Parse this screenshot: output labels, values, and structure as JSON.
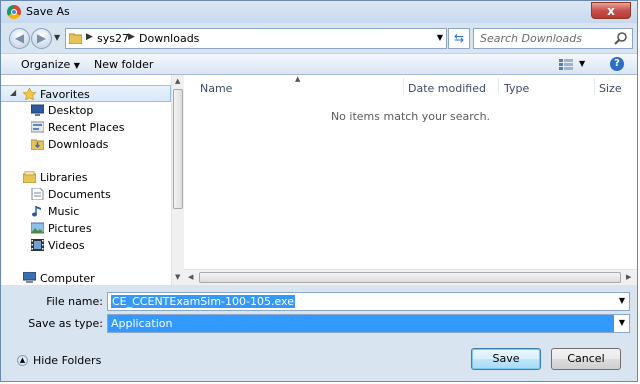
{
  "window": {
    "title": "Save As",
    "close_label": "x"
  },
  "nav": {
    "path": [
      "sys27",
      "Downloads"
    ],
    "search_placeholder": "Search Downloads"
  },
  "toolbar": {
    "organize_label": "Organize",
    "new_folder_label": "New folder"
  },
  "sidebar": {
    "favorites": {
      "label": "Favorites",
      "items": [
        "Desktop",
        "Recent Places",
        "Downloads"
      ]
    },
    "libraries": {
      "label": "Libraries",
      "items": [
        "Documents",
        "Music",
        "Pictures",
        "Videos"
      ]
    },
    "computer": {
      "label": "Computer"
    }
  },
  "file_list": {
    "columns": [
      "Name",
      "Date modified",
      "Type",
      "Size"
    ],
    "empty_message": "No items match your search."
  },
  "form": {
    "filename_label": "File name:",
    "filename_value": "CE_CCENTExamSim-100-105.exe",
    "filetype_label": "Save as type:",
    "filetype_value": "Application"
  },
  "footer": {
    "hide_folders_label": "Hide Folders",
    "save_label": "Save",
    "cancel_label": "Cancel"
  },
  "colors": {
    "selection": "#3399ff",
    "frame": "#d9e4f1"
  }
}
